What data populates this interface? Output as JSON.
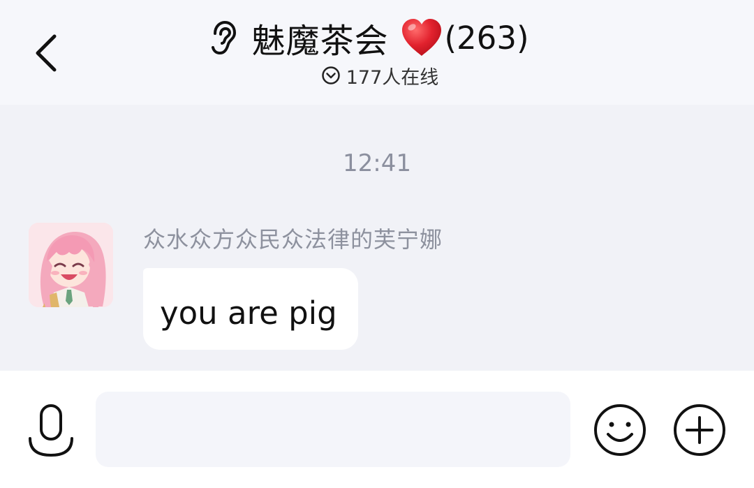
{
  "header": {
    "title": "魅魔茶会",
    "title_emoji": "heart-emoji",
    "member_count": "(263)",
    "online_status": "177人在线",
    "accent_heart_color": "#e2222e"
  },
  "chat": {
    "timestamp": "12:41",
    "messages": [
      {
        "sender": "众水众方众民众法律的芙宁娜",
        "text": "you are pig",
        "avatar": "anime-girl-avatar"
      }
    ]
  },
  "input_bar": {
    "placeholder": "",
    "value": ""
  },
  "icons": {
    "back": "chevron-left-icon",
    "ear": "ear-icon",
    "online": "chevron-down-circle-icon",
    "voice": "microphone-icon",
    "emoji": "smiley-icon",
    "plus": "plus-circle-icon"
  },
  "colors": {
    "header_bg": "#f6f7fb",
    "chat_bg": "#f1f2f7",
    "bubble_bg": "#ffffff",
    "muted_text": "#8d919e"
  }
}
